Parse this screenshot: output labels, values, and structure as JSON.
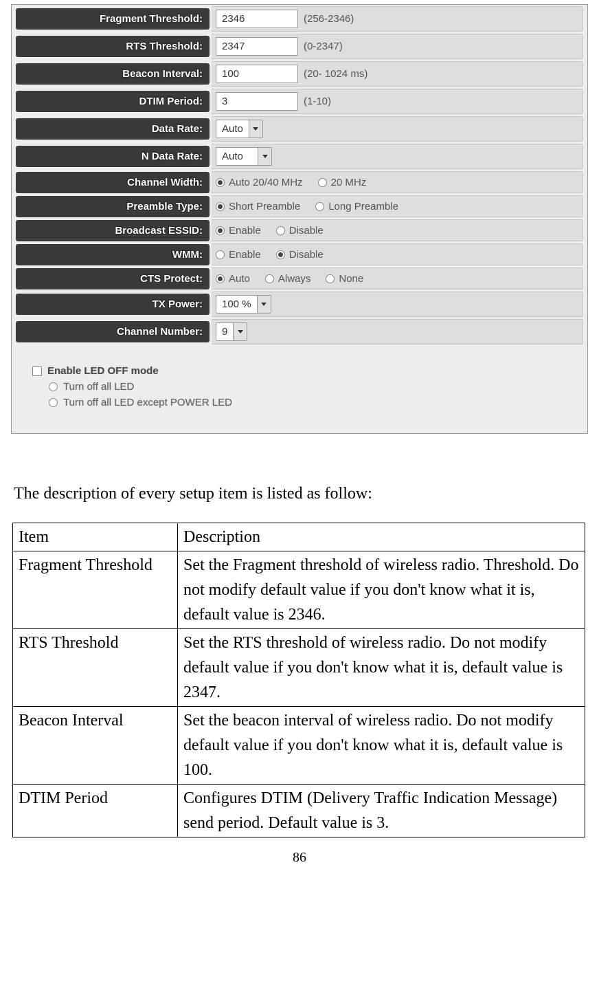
{
  "form": {
    "fragment_threshold": {
      "label": "Fragment Threshold:",
      "value": "2346",
      "hint": "(256-2346)"
    },
    "rts_threshold": {
      "label": "RTS Threshold:",
      "value": "2347",
      "hint": "(0-2347)"
    },
    "beacon_interval": {
      "label": "Beacon Interval:",
      "value": "100",
      "hint": "(20- 1024 ms)"
    },
    "dtim_period": {
      "label": "DTIM Period:",
      "value": "3",
      "hint": "(1-10)"
    },
    "data_rate": {
      "label": "Data Rate:",
      "value": "Auto"
    },
    "n_data_rate": {
      "label": "N Data Rate:",
      "value": "Auto"
    },
    "channel_width": {
      "label": "Channel Width:",
      "opt1": "Auto 20/40 MHz",
      "opt2": "20 MHz"
    },
    "preamble_type": {
      "label": "Preamble Type:",
      "opt1": "Short Preamble",
      "opt2": "Long Preamble"
    },
    "broadcast_essid": {
      "label": "Broadcast ESSID:",
      "opt1": "Enable",
      "opt2": "Disable"
    },
    "wmm": {
      "label": "WMM:",
      "opt1": "Enable",
      "opt2": "Disable"
    },
    "cts_protect": {
      "label": "CTS Protect:",
      "opt1": "Auto",
      "opt2": "Always",
      "opt3": "None"
    },
    "tx_power": {
      "label": "TX Power:",
      "value": "100 %"
    },
    "channel_number": {
      "label": "Channel Number:",
      "value": "9"
    }
  },
  "led": {
    "enable_label": "Enable LED OFF mode",
    "opt1": "Turn off all LED",
    "opt2": "Turn off all LED except POWER LED"
  },
  "intro_text": "The description of every setup item is listed as follow:",
  "table": {
    "header_item": "Item",
    "header_desc": "Description",
    "rows": [
      {
        "item": "Fragment Threshold",
        "desc": "Set the Fragment threshold of wireless radio. Threshold. Do not modify default value if you don't know what it is, default value is 2346."
      },
      {
        "item": "RTS Threshold",
        "desc": "Set the RTS threshold of wireless radio. Do not modify default value if you don't know what it is, default value is 2347."
      },
      {
        "item": "Beacon Interval",
        "desc": "Set the beacon interval of wireless radio. Do not modify default value if you don't know what it is, default value is 100."
      },
      {
        "item": "DTIM Period",
        "desc": "Configures DTIM (Delivery Traffic Indication Message) send period. Default value is 3."
      }
    ]
  },
  "page_number": "86"
}
